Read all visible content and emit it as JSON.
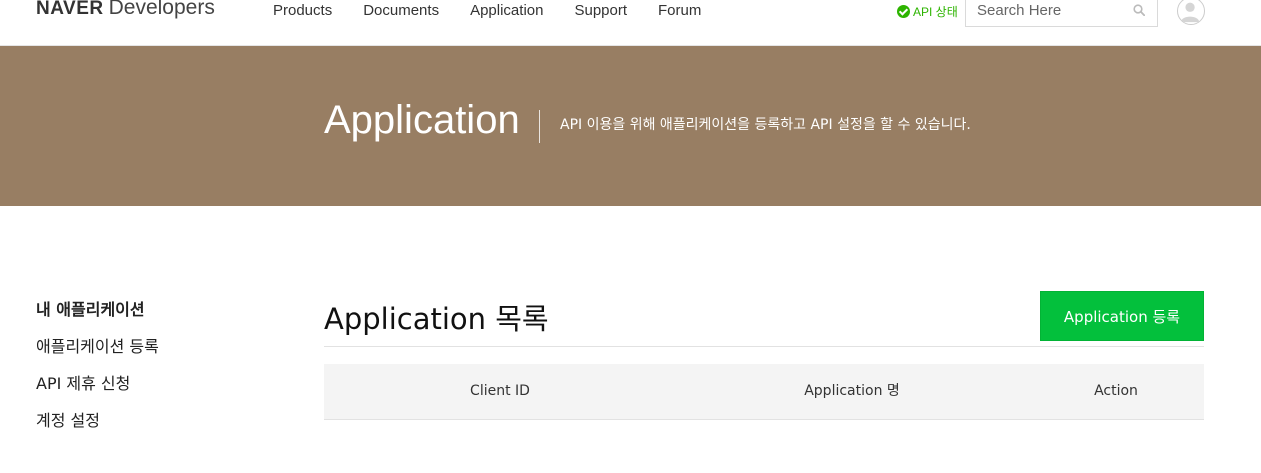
{
  "header": {
    "logo": {
      "brand": "NAVER",
      "sub": "Developers"
    },
    "nav": [
      "Products",
      "Documents",
      "Application",
      "Support",
      "Forum"
    ],
    "api_status": "API 상태",
    "search_placeholder": "Search Here"
  },
  "banner": {
    "title": "Application",
    "description": "API 이용을 위해 애플리케이션을 등록하고 API 설정을 할 수 있습니다."
  },
  "sidebar": {
    "items": [
      "내 애플리케이션",
      "애플리케이션 등록",
      "API 제휴 신청",
      "계정 설정"
    ]
  },
  "main": {
    "title": "Application 목록",
    "register_button": "Application 등록",
    "columns": [
      "Client ID",
      "Application 명",
      "Action"
    ]
  },
  "colors": {
    "banner": "#987e63",
    "accent_green": "#03c03c",
    "status_green": "#2db400"
  }
}
